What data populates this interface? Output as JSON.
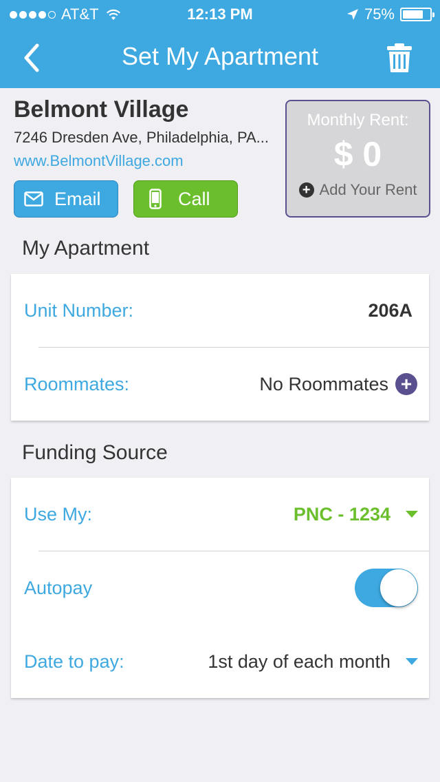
{
  "status_bar": {
    "carrier": "AT&T",
    "time": "12:13 PM",
    "battery": "75%",
    "battery_level": 0.75,
    "signal_bars_filled": 4,
    "signal_bars_total": 5
  },
  "navbar": {
    "title": "Set My Apartment",
    "back_icon": "chevron-left-icon",
    "trash_icon": "trash-icon"
  },
  "property": {
    "name": "Belmont Village",
    "address": "7246 Dresden Ave, Philadelphia, PA...",
    "website": "www.BelmontVillage.com",
    "email_label": "Email",
    "call_label": "Call"
  },
  "rent": {
    "label": "Monthly Rent:",
    "value": "$ 0",
    "add_label": "Add Your Rent"
  },
  "my_apartment": {
    "title": "My Apartment",
    "unit_label": "Unit Number:",
    "unit_value": "206A",
    "roommates_label": "Roommates:",
    "roommates_value": "No Roommates"
  },
  "funding": {
    "title": "Funding Source",
    "use_label": "Use My:",
    "use_value": "PNC - 1234",
    "autopay_label": "Autopay",
    "autopay_on": true,
    "date_label": "Date to pay:",
    "date_value": "1st day of each month"
  },
  "colors": {
    "primary": "#3ea8e0",
    "green": "#6cbf2c",
    "funding_value": "#6cbf2c",
    "purple": "#5a4f8f"
  }
}
